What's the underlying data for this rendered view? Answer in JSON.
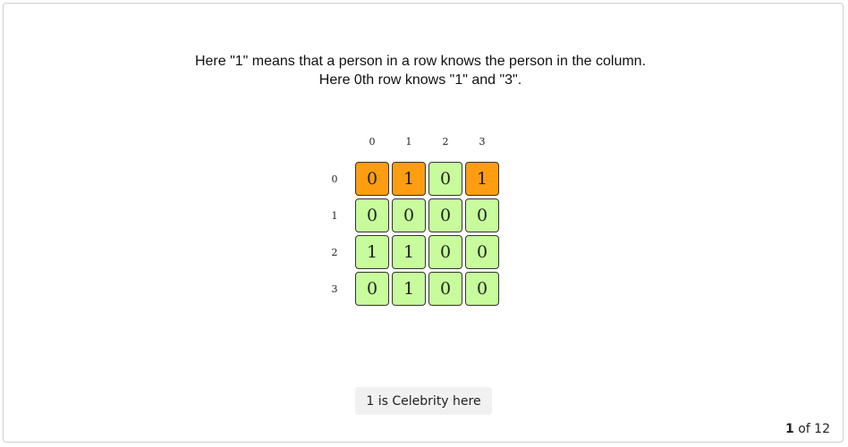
{
  "caption": {
    "line1": "Here \"1\" means that a person in a row knows the person in the column.",
    "line2": "Here 0th row knows \"1\" and \"3\"."
  },
  "matrix": {
    "col_labels": [
      "0",
      "1",
      "2",
      "3"
    ],
    "row_labels": [
      "0",
      "1",
      "2",
      "3"
    ],
    "rows": [
      [
        "0",
        "1",
        "0",
        "1"
      ],
      [
        "0",
        "0",
        "0",
        "0"
      ],
      [
        "1",
        "1",
        "0",
        "0"
      ],
      [
        "0",
        "1",
        "0",
        "0"
      ]
    ],
    "highlight": [
      [
        "orange",
        "orange",
        "green",
        "orange"
      ],
      [
        "green",
        "green",
        "green",
        "green"
      ],
      [
        "green",
        "green",
        "green",
        "green"
      ],
      [
        "green",
        "green",
        "green",
        "green"
      ]
    ],
    "colors": {
      "green": "#c7fb9c",
      "orange": "#ff9d12"
    }
  },
  "status_text": "1 is Celebrity here",
  "pager": {
    "current": "1",
    "separator": "of",
    "total": "12"
  }
}
